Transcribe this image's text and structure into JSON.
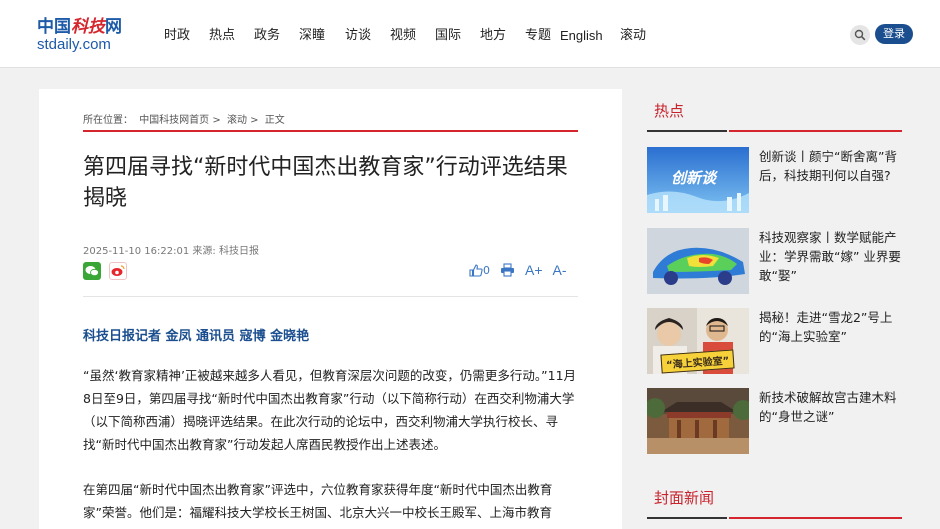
{
  "header": {
    "logo_cn_a": "中国",
    "logo_cn_b": "科技",
    "logo_cn_c": "网",
    "logo_en": "stdaily.com",
    "nav": [
      "时政",
      "热点",
      "政务",
      "深瞳",
      "访谈",
      "视频",
      "国际",
      "地方",
      "专题",
      "English",
      "滚动"
    ],
    "login_label": "登录"
  },
  "article": {
    "breadcrumb_prefix": "所在位置：",
    "breadcrumb_home": "中国科技网首页",
    "breadcrumb_sep1": ">",
    "breadcrumb_section": "滚动",
    "breadcrumb_sep2": ">",
    "breadcrumb_current": "正文",
    "title": "第四届寻找“新时代中国杰出教育家”行动评选结果揭晓",
    "datetime": "2025-11-10 16:22:01",
    "source": "来源: 科技日报",
    "like_count": "0",
    "font_larger": "A+",
    "font_smaller": "A-",
    "byline": "科技日报记者 金凤 通讯员 寇博 金晓艳",
    "paragraph1": "“虽然‘教育家精神’正被越来越多人看见，但教育深层次问题的改变，仍需更多行动。”11月8日至9日，第四届寻找“新时代中国杰出教育家”行动（以下简称行动）在西交利物浦大学（以下简称西浦）揭晓评选结果。在此次行动的论坛中，西交利物浦大学执行校长、寻找“新时代中国杰出教育家”行动发起人席酉民教授作出上述表述。",
    "paragraph2": "在第四届“新时代中国杰出教育家”评选中，六位教育家获得年度“新时代中国杰出教育家”荣誉。他们是：福耀科技大学校长王树国、北京大兴一中校长王殿军、上海市教育"
  },
  "sidebar": {
    "hot_title": "热点",
    "news": [
      {
        "title": "创新谈丨颜宁“断舍离”背后，科技期刊何以自强?",
        "thumb_text": "创新谈"
      },
      {
        "title": "科技观察家丨数学赋能产业：学界需敢“嫁” 业界要敢“娶”",
        "thumb_text": ""
      },
      {
        "title": "揭秘！走进“雪龙2”号上的“海上实验室”",
        "thumb_text": "“海上实验室”"
      },
      {
        "title": "新技术破解故宫古建木料的“身世之谜”",
        "thumb_text": ""
      }
    ],
    "cover_title": "封面新闻"
  },
  "colors": {
    "brand_blue": "#1b4e8f",
    "accent_red": "#d6262d"
  }
}
